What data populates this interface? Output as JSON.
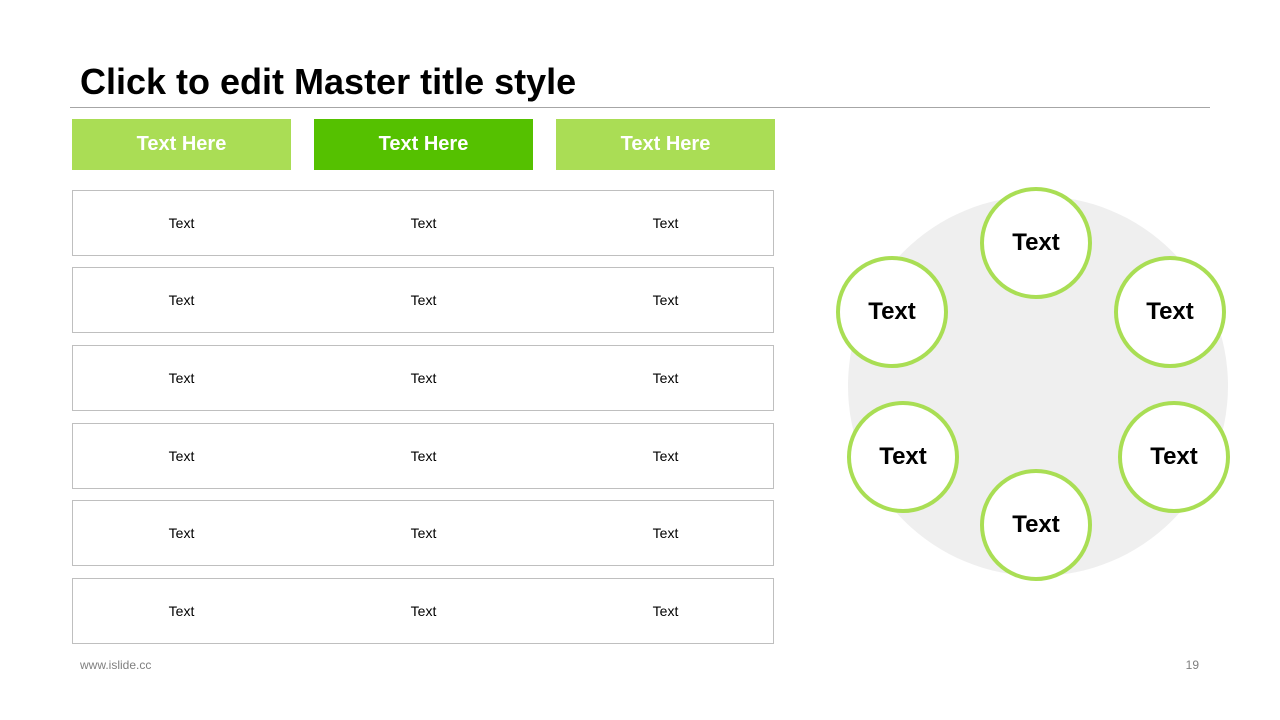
{
  "slide": {
    "title": "Click to edit Master title style",
    "footer_left": "www.islide.cc",
    "page_number": "19"
  },
  "colors": {
    "light_green": "#aadd55",
    "dark_green": "#55c100",
    "circle_border": "#a9de54",
    "disc_fill": "#efefef"
  },
  "headers": [
    "Text Here",
    "Text Here",
    "Text Here"
  ],
  "rows": [
    [
      "Text",
      "Text",
      "Text"
    ],
    [
      "Text",
      "Text",
      "Text"
    ],
    [
      "Text",
      "Text",
      "Text"
    ],
    [
      "Text",
      "Text",
      "Text"
    ],
    [
      "Text",
      "Text",
      "Text"
    ],
    [
      "Text",
      "Text",
      "Text"
    ]
  ],
  "cycle": {
    "nodes": [
      "Text",
      "Text",
      "Text",
      "Text",
      "Text",
      "Text"
    ]
  }
}
